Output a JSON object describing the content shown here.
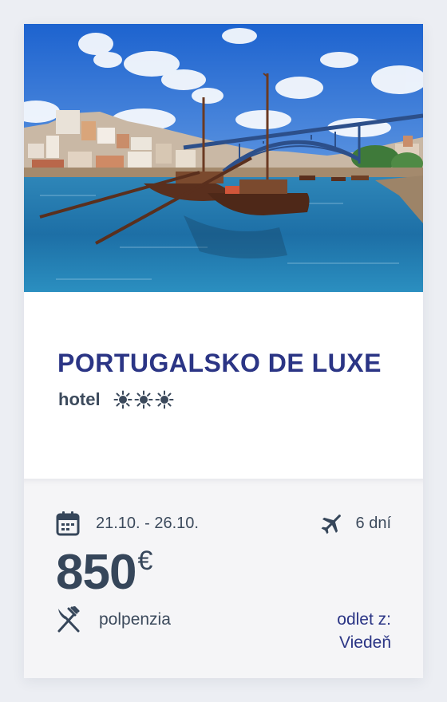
{
  "card": {
    "image": {
      "alt": "Porto, boats on the Douro river and the Dom Luís I bridge",
      "colors": {
        "sky_top": "#1f6ed8",
        "sky_bottom": "#7fb3ec",
        "water": "#1f6aa3"
      }
    },
    "title": "PORTUGALSKO DE LUXE",
    "accommodation": {
      "label": "hotel",
      "stars": 3,
      "star_icon": "sun-icon"
    },
    "dates": {
      "icon": "calendar-icon",
      "value": "21.10. - 26.10."
    },
    "duration": {
      "icon": "airplane-icon",
      "value": "6 dní"
    },
    "price": {
      "value": "850",
      "currency": "€"
    },
    "board": {
      "icon": "fork-knife-icon",
      "value": "polpenzia"
    },
    "departure": {
      "label": "odlet z:",
      "city": "Viedeň"
    },
    "colors": {
      "title": "#2b3585",
      "text": "#3c4a5c",
      "background": "#eceef3",
      "details_bg": "#f5f5f7"
    }
  }
}
